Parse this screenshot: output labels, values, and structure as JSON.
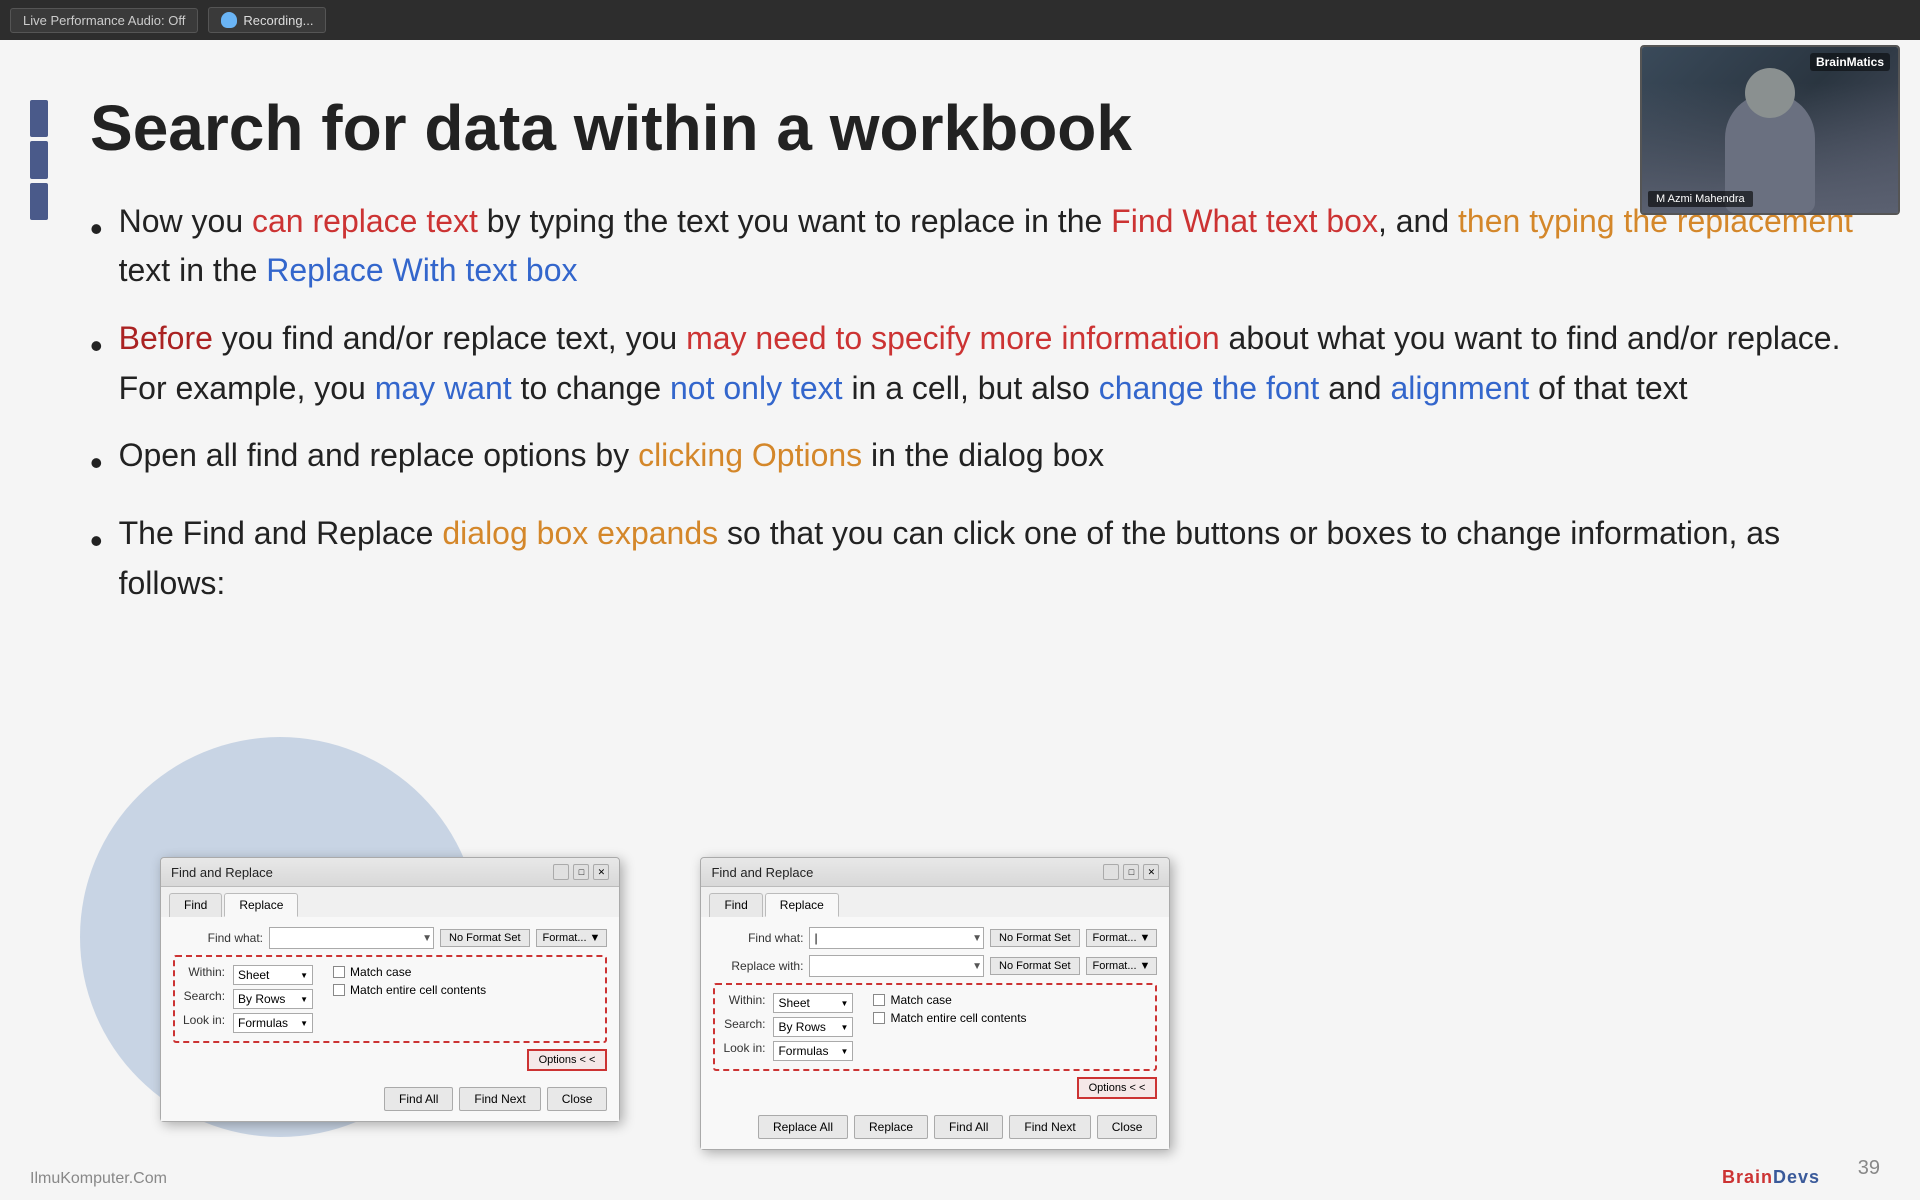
{
  "topbar": {
    "live_audio_btn": "Live Performance Audio: Off",
    "recording_btn": "Recording..."
  },
  "slide": {
    "title": "Search for data within a workbook",
    "bullets": [
      {
        "text_parts": [
          {
            "text": "Now you ",
            "style": "normal"
          },
          {
            "text": "can replace text",
            "style": "red"
          },
          {
            "text": " by typing the text you want to replace in the ",
            "style": "normal"
          },
          {
            "text": "Find What text box",
            "style": "red"
          },
          {
            "text": ", and ",
            "style": "normal"
          },
          {
            "text": "then typing the replacement",
            "style": "orange"
          },
          {
            "text": " text in the ",
            "style": "normal"
          },
          {
            "text": "Replace With text box",
            "style": "blue"
          }
        ]
      },
      {
        "text_parts": [
          {
            "text": "Before",
            "style": "dark-red"
          },
          {
            "text": " you find and/or replace text, you ",
            "style": "normal"
          },
          {
            "text": "may need to specify more information",
            "style": "red"
          },
          {
            "text": " about what you want to find and/or replace. For example, you ",
            "style": "normal"
          },
          {
            "text": "may want",
            "style": "blue"
          },
          {
            "text": " to change ",
            "style": "normal"
          },
          {
            "text": "not only text",
            "style": "blue"
          },
          {
            "text": " in a cell, but also ",
            "style": "normal"
          },
          {
            "text": "change the font",
            "style": "blue"
          },
          {
            "text": " and ",
            "style": "normal"
          },
          {
            "text": "alignment",
            "style": "blue"
          },
          {
            "text": " of that text",
            "style": "normal"
          }
        ]
      },
      {
        "text_parts": [
          {
            "text": "Open all find and replace options by ",
            "style": "normal"
          },
          {
            "text": "clicking Options",
            "style": "orange"
          },
          {
            "text": " in the dialog box",
            "style": "normal"
          }
        ]
      },
      {
        "text_parts": [
          {
            "text": "The Find and Replace ",
            "style": "normal"
          },
          {
            "text": "dialog box expands",
            "style": "orange"
          },
          {
            "text": " so that you can click one of the buttons or boxes to change information, as follows:",
            "style": "normal"
          }
        ]
      }
    ]
  },
  "webcam": {
    "logo": "BrainMatics",
    "person_name": "M Azmi Mahendra"
  },
  "dialog1": {
    "title": "Find and Replace",
    "tabs": [
      "Find",
      "Replace"
    ],
    "active_tab": "Replace",
    "find_what_label": "Find what:",
    "find_what_value": "",
    "find_what_format_btn": "No Format Set",
    "find_what_format_dropdown": "Format...",
    "within_label": "Within:",
    "within_value": "Sheet",
    "search_label": "Search:",
    "search_value": "By Rows",
    "look_in_label": "Look in:",
    "look_in_value": "Formulas",
    "match_case_label": "Match case",
    "match_cell_label": "Match entire cell contents",
    "options_btn": "Options < <",
    "btns": [
      "Find All",
      "Find Next",
      "Close"
    ]
  },
  "dialog2": {
    "title": "Find and Replace",
    "tabs": [
      "Find",
      "Replace"
    ],
    "active_tab": "Replace",
    "find_what_label": "Find what:",
    "find_what_value": "|",
    "find_what_format_btn": "No Format Set",
    "find_what_format_dropdown": "Format...",
    "replace_with_label": "Replace with:",
    "replace_with_value": "",
    "replace_with_format_btn": "No Format Set",
    "replace_with_format_dropdown": "Format...",
    "within_label": "Within:",
    "within_value": "Sheet",
    "search_label": "Search:",
    "search_value": "By Rows",
    "look_in_label": "Look in:",
    "look_in_value": "Formulas",
    "match_case_label": "Match case",
    "match_cell_label": "Match entire cell contents",
    "options_btn": "Options < <",
    "btns": [
      "Replace All",
      "Replace",
      "Find All",
      "Find Next",
      "Close"
    ]
  },
  "footer": {
    "watermark": "IlmuKomputer.Com",
    "slide_number": "39",
    "brand": "BrainDevs"
  }
}
